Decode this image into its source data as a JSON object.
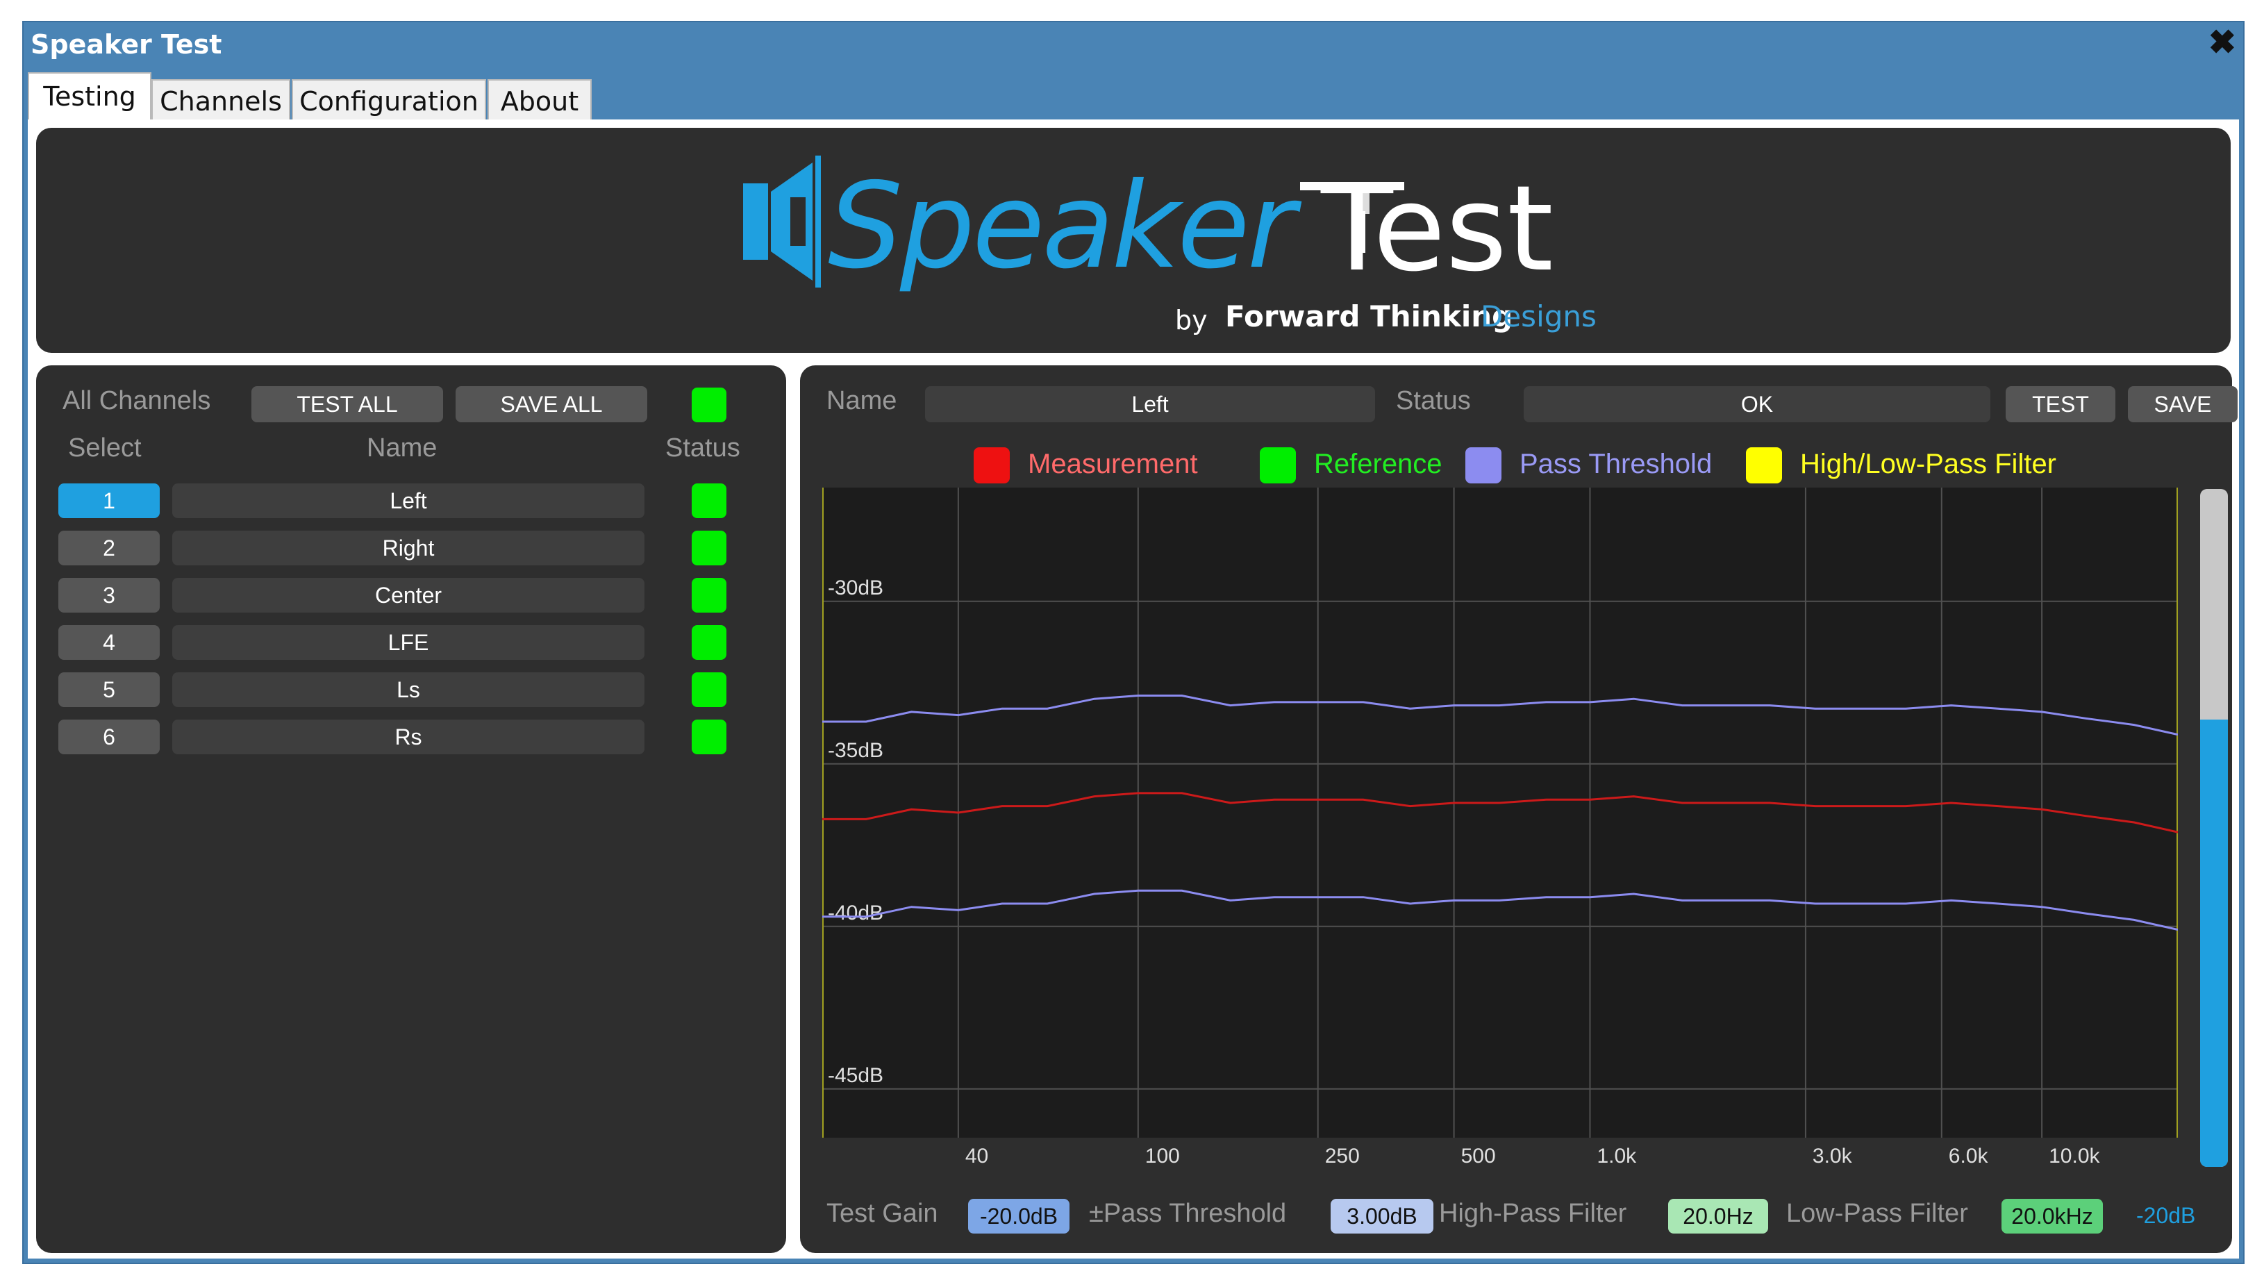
{
  "window": {
    "title": "Speaker Test"
  },
  "tabs": [
    "Testing",
    "Channels",
    "Configuration",
    "About"
  ],
  "banner": {
    "logo_word1": "Speaker",
    "logo_word2": "Test",
    "byline_by": "by",
    "byline_brand": "Forward Thinking",
    "byline_designs": "Designs"
  },
  "channels": {
    "all_label": "All Channels",
    "test_all": "TEST ALL",
    "save_all": "SAVE ALL",
    "col_select": "Select",
    "col_name": "Name",
    "col_status": "Status",
    "rows": [
      {
        "num": "1",
        "name": "Left",
        "selected": true
      },
      {
        "num": "2",
        "name": "Right"
      },
      {
        "num": "3",
        "name": "Center"
      },
      {
        "num": "4",
        "name": "LFE"
      },
      {
        "num": "5",
        "name": "Ls"
      },
      {
        "num": "6",
        "name": "Rs"
      }
    ]
  },
  "detail": {
    "name_label": "Name",
    "name_value": "Left",
    "status_label": "Status",
    "status_value": "OK",
    "test": "TEST",
    "save": "SAVE"
  },
  "legend": [
    {
      "label": "Measurement",
      "color": "#ee1111",
      "text_color": "#ff6a6a"
    },
    {
      "label": "Reference",
      "color": "#00ee00",
      "text_color": "#22ee22"
    },
    {
      "label": "Pass Threshold",
      "color": "#8c8cf0",
      "text_color": "#9a9af5"
    },
    {
      "label": "High/Low-Pass Filter",
      "color": "#ffff00",
      "text_color": "#ffff22"
    }
  ],
  "chart_data": {
    "type": "line",
    "x_scale": "log",
    "y_tick_labels": [
      "-30dB",
      "-35dB",
      "-40dB",
      "-45dB"
    ],
    "y_ticks": [
      -30,
      -35,
      -40,
      -45
    ],
    "x_tick_labels": [
      "40",
      "100",
      "250",
      "500",
      "1.0k",
      "3.0k",
      "6.0k",
      "10.0k"
    ],
    "x_ticks": [
      40,
      100,
      250,
      500,
      1000,
      3000,
      6000,
      10000
    ],
    "xlim": [
      20,
      20000
    ],
    "ylim": [
      -46.5,
      -26.5
    ],
    "grid": true,
    "x": [
      20,
      25,
      31.5,
      40,
      50,
      63,
      80,
      100,
      125,
      160,
      200,
      250,
      315,
      400,
      500,
      630,
      800,
      1000,
      1250,
      1600,
      2000,
      2500,
      3150,
      4000,
      5000,
      6300,
      8000,
      10000,
      12500,
      16000,
      20000
    ],
    "series": [
      {
        "name": "Measurement",
        "color": "#cc1a1a",
        "values": [
          -36.7,
          -36.7,
          -36.4,
          -36.5,
          -36.3,
          -36.3,
          -36.0,
          -35.9,
          -35.9,
          -36.2,
          -36.1,
          -36.1,
          -36.1,
          -36.3,
          -36.2,
          -36.2,
          -36.1,
          -36.1,
          -36.0,
          -36.2,
          -36.2,
          -36.2,
          -36.3,
          -36.3,
          -36.3,
          -36.2,
          -36.3,
          -36.4,
          -36.6,
          -36.8,
          -37.1
        ]
      },
      {
        "name": "Pass Threshold",
        "color": "#8c8cf0",
        "values": [
          -33.7,
          -33.7,
          -33.4,
          -33.5,
          -33.3,
          -33.3,
          -33.0,
          -32.9,
          -32.9,
          -33.2,
          -33.1,
          -33.1,
          -33.1,
          -33.3,
          -33.2,
          -33.2,
          -33.1,
          -33.1,
          -33.0,
          -33.2,
          -33.2,
          -33.2,
          -33.3,
          -33.3,
          -33.3,
          -33.2,
          -33.3,
          -33.4,
          -33.6,
          -33.8,
          -34.1
        ]
      },
      {
        "name": "Pass Threshold",
        "color": "#8c8cf0",
        "values": [
          -39.7,
          -39.7,
          -39.4,
          -39.5,
          -39.3,
          -39.3,
          -39.0,
          -38.9,
          -38.9,
          -39.2,
          -39.1,
          -39.1,
          -39.1,
          -39.3,
          -39.2,
          -39.2,
          -39.1,
          -39.1,
          -39.0,
          -39.2,
          -39.2,
          -39.2,
          -39.3,
          -39.3,
          -39.3,
          -39.2,
          -39.3,
          -39.4,
          -39.6,
          -39.8,
          -40.1
        ]
      }
    ],
    "filter_lines": [
      20,
      20000
    ]
  },
  "level_meter": {
    "label": "-20dB",
    "fraction": 0.66
  },
  "footer": {
    "gain_label": "Test Gain",
    "gain_value": "-20.0dB",
    "threshold_label": "±Pass Threshold",
    "threshold_value": "3.00dB",
    "hpf_label": "High-Pass Filter",
    "hpf_value": "20.0Hz",
    "lpf_label": "Low-Pass Filter",
    "lpf_value": "20.0kHz"
  }
}
